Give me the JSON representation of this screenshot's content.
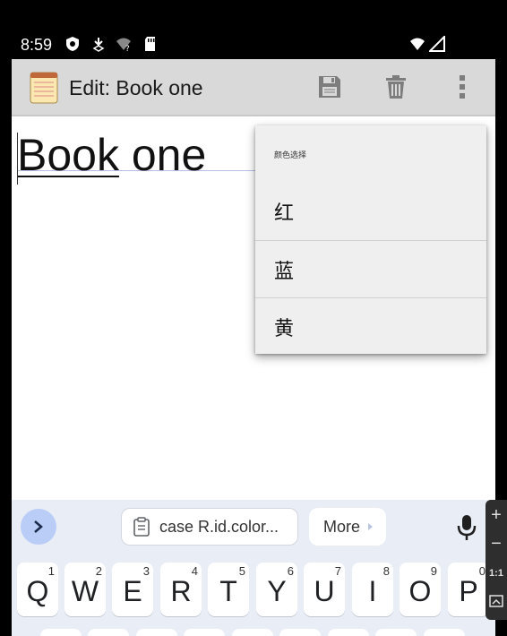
{
  "status_bar": {
    "time": "8:59"
  },
  "app_bar": {
    "title": "Edit: Book one",
    "save_icon": "save-icon",
    "delete_icon": "trash-icon",
    "overflow_icon": "more-vert-icon"
  },
  "editor": {
    "title_underlined": "Book",
    "title_rest": " one"
  },
  "popup_menu": {
    "header": "颜色选择",
    "items": [
      {
        "label": "红"
      },
      {
        "label": "蓝"
      },
      {
        "label": "黄"
      }
    ]
  },
  "keyboard": {
    "clipboard_chip": "case R.id.color...",
    "more_chip": "More",
    "keys": [
      {
        "label": "Q",
        "num": "1"
      },
      {
        "label": "W",
        "num": "2"
      },
      {
        "label": "E",
        "num": "3"
      },
      {
        "label": "R",
        "num": "4"
      },
      {
        "label": "T",
        "num": "5"
      },
      {
        "label": "Y",
        "num": "6"
      },
      {
        "label": "U",
        "num": "7"
      },
      {
        "label": "I",
        "num": "8"
      },
      {
        "label": "O",
        "num": "9"
      },
      {
        "label": "P",
        "num": "0"
      }
    ]
  },
  "side_panel": {
    "zoom_in": "+",
    "zoom_out": "−",
    "one_to_one": "1:1"
  },
  "colors": {
    "app_bar_bg": "#d9d9d9",
    "popup_bg": "#efefef",
    "keyboard_bg": "#e9edf6",
    "expand_button": "#b9cdf6"
  }
}
